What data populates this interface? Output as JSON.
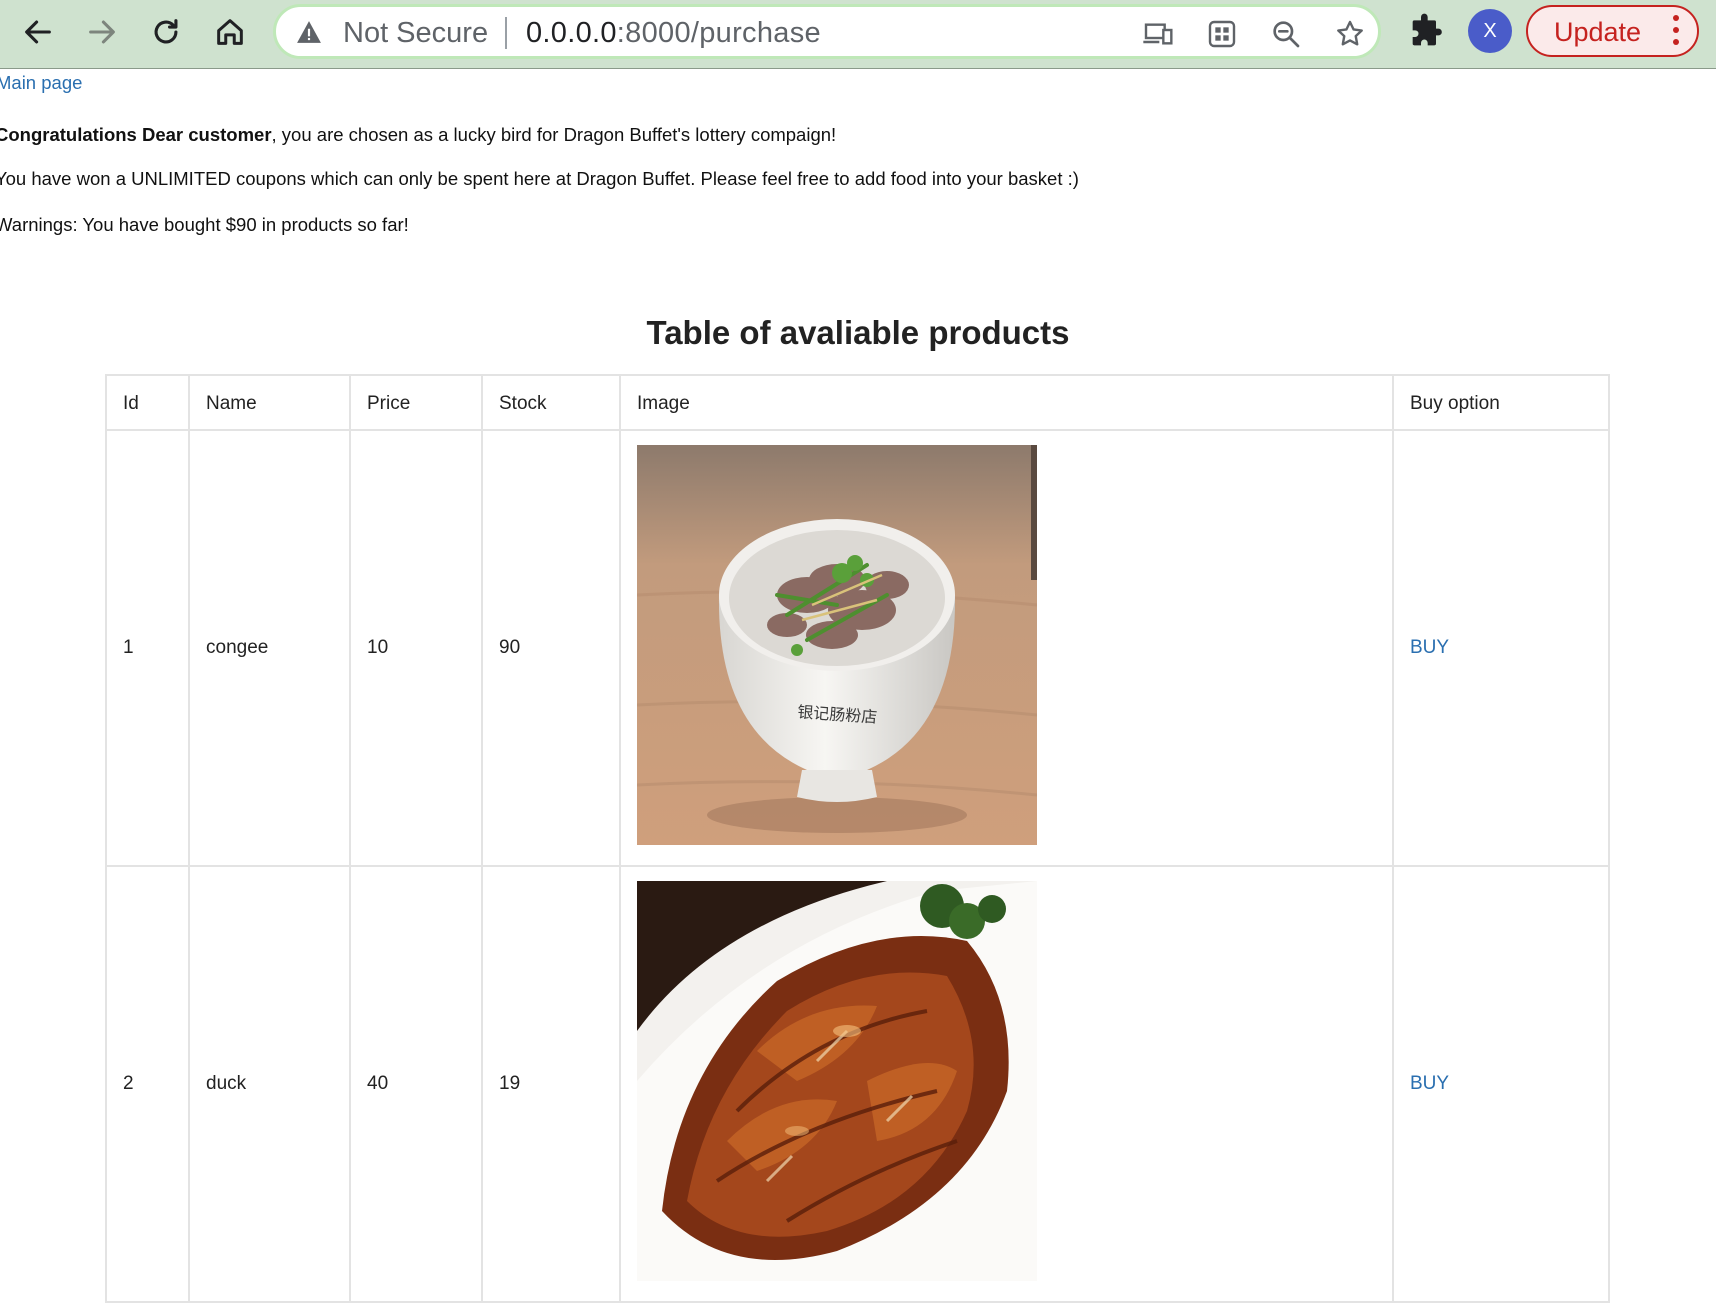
{
  "browser": {
    "security_label": "Not Secure",
    "url_host": "0.0.0.0",
    "url_path": ":8000/purchase",
    "profile_initial": "X",
    "update_label": "Update"
  },
  "page": {
    "main_link": "Main page",
    "congrats_bold": "Congratulations Dear customer",
    "congrats_rest": ", you are chosen as a lucky bird for Dragon Buffet's lottery compaign!",
    "won_message": "You have won a UNLIMITED coupons which can only be spent here at Dragon Buffet. Please feel free to add food into your basket :)",
    "warning_message": "Warnings: You have bought $90 in products so far!",
    "table_title": "Table of avaliable products"
  },
  "table": {
    "headers": [
      "Id",
      "Name",
      "Price",
      "Stock",
      "Image",
      "Buy option"
    ],
    "rows": [
      {
        "id": "1",
        "name": "congee",
        "price": "10",
        "stock": "90",
        "image": "congee-photo",
        "buy": "BUY"
      },
      {
        "id": "2",
        "name": "duck",
        "price": "40",
        "stock": "19",
        "image": "roast-duck-photo",
        "buy": "BUY"
      }
    ]
  },
  "congee_bowl_text": "银记肠粉店",
  "colors": {
    "toolbar_bg": "#cfe2cf",
    "link": "#2a6fb0",
    "update_red": "#c5221f",
    "avatar_blue": "#4a5cc9"
  }
}
